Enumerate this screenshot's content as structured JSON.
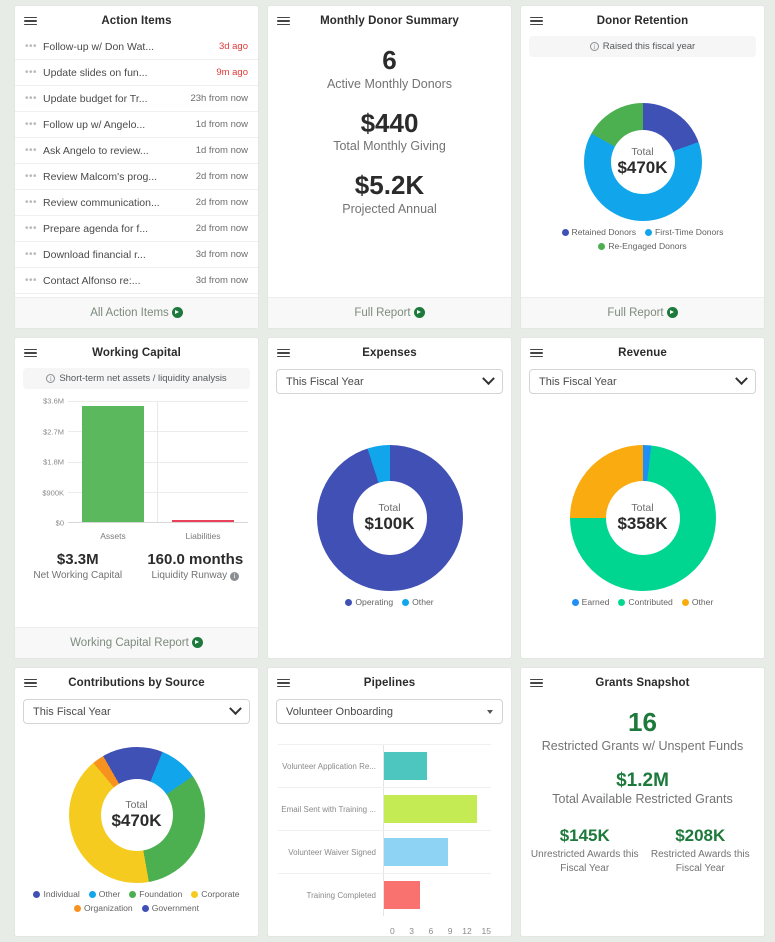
{
  "cards": {
    "action_items": {
      "title": "Action Items",
      "menu_icon": "hamburger-icon",
      "items": [
        {
          "label": "Follow-up w/ Don Wat...",
          "due": "3d ago",
          "overdue": true
        },
        {
          "label": "Update slides on fun...",
          "due": "9m ago",
          "overdue": true
        },
        {
          "label": "Update budget for Tr...",
          "due": "23h from now",
          "overdue": false
        },
        {
          "label": "Follow up w/ Angelo...",
          "due": "1d from now",
          "overdue": false
        },
        {
          "label": "Ask Angelo to review...",
          "due": "1d from now",
          "overdue": false
        },
        {
          "label": "Review Malcom's prog...",
          "due": "2d from now",
          "overdue": false
        },
        {
          "label": "Review communication...",
          "due": "2d from now",
          "overdue": false
        },
        {
          "label": "Prepare agenda for f...",
          "due": "2d from now",
          "overdue": false
        },
        {
          "label": "Download financial r...",
          "due": "3d from now",
          "overdue": false
        },
        {
          "label": "Contact Alfonso re:...",
          "due": "3d from now",
          "overdue": false
        }
      ],
      "footer": "All Action Items"
    },
    "monthly_donor_summary": {
      "title": "Monthly Donor Summary",
      "stats": [
        {
          "value": "6",
          "label": "Active Monthly Donors"
        },
        {
          "value": "$440",
          "label": "Total Monthly Giving"
        },
        {
          "value": "$5.2K",
          "label": "Projected Annual"
        }
      ],
      "footer": "Full Report"
    },
    "donor_retention": {
      "title": "Donor Retention",
      "banner": "Raised this fiscal year",
      "center_label": "Total",
      "center_value": "$470K",
      "footer": "Full Report"
    },
    "working_capital": {
      "title": "Working Capital",
      "banner": "Short-term net assets / liquidity analysis",
      "stats": [
        {
          "value": "$3.3M",
          "label": "Net Working Capital",
          "info": false
        },
        {
          "value": "160.0 months",
          "label": "Liquidity Runway",
          "info": true
        }
      ],
      "footer": "Working Capital Report"
    },
    "expenses": {
      "title": "Expenses",
      "filter": "This Fiscal Year",
      "center_label": "Total",
      "center_value": "$100K"
    },
    "revenue": {
      "title": "Revenue",
      "filter": "This Fiscal Year",
      "center_label": "Total",
      "center_value": "$358K"
    },
    "contributions_by_source": {
      "title": "Contributions by Source",
      "filter": "This Fiscal Year",
      "center_label": "Total",
      "center_value": "$470K"
    },
    "pipelines": {
      "title": "Pipelines",
      "filter": "Volunteer Onboarding"
    },
    "grants_snapshot": {
      "title": "Grants Snapshot",
      "stats": [
        {
          "value": "16",
          "label": "Restricted Grants w/ Unspent Funds"
        },
        {
          "value": "$1.2M",
          "label": "Total Available Restricted Grants"
        }
      ],
      "two_up": [
        {
          "value": "$145K",
          "label": "Unrestricted Awards this Fiscal Year"
        },
        {
          "value": "$208K",
          "label": "Restricted Awards this Fiscal Year"
        }
      ]
    }
  },
  "chart_data": [
    {
      "id": "donor_retention",
      "type": "pie",
      "title": "Donor Retention",
      "center_label": "Total",
      "center_value": "$470K",
      "total": 470000,
      "legend_position": "bottom",
      "categories": [
        "Retained Donors",
        "First-Time Donors",
        "Re-Engaged Donors"
      ],
      "values": [
        19.5,
        63.5,
        17.0
      ],
      "colors": [
        "#3f51b5",
        "#11a5ec",
        "#4caf50"
      ]
    },
    {
      "id": "working_capital",
      "type": "bar",
      "title": "Working Capital",
      "categories": [
        "Assets",
        "Liabilities"
      ],
      "values": [
        3450000,
        45000
      ],
      "colors": [
        "#5cb85c",
        "#e8415a"
      ],
      "ylim": [
        0,
        3600000
      ],
      "yticks": [
        "$0",
        "$900K",
        "$1.8M",
        "$2.7M",
        "$3.6M"
      ],
      "xlabel": "",
      "ylabel": "",
      "grid": true
    },
    {
      "id": "expenses",
      "type": "pie",
      "title": "Expenses",
      "center_label": "Total",
      "center_value": "$100K",
      "total": 100000,
      "legend_position": "bottom",
      "categories": [
        "Operating",
        "Other"
      ],
      "values": [
        95.0,
        5.0
      ],
      "colors": [
        "#4050b5",
        "#11a5ec"
      ]
    },
    {
      "id": "revenue",
      "type": "pie",
      "title": "Revenue",
      "center_label": "Total",
      "center_value": "$358K",
      "total": 358000,
      "legend_position": "bottom",
      "categories": [
        "Earned",
        "Contributed",
        "Other"
      ],
      "values": [
        1.8,
        73.2,
        25.0
      ],
      "colors": [
        "#1f8ff5",
        "#00d68f",
        "#f9ab10"
      ]
    },
    {
      "id": "contributions_by_source",
      "type": "pie",
      "title": "Contributions by Source",
      "center_label": "Total",
      "center_value": "$470K",
      "total": 470000,
      "legend_position": "bottom",
      "categories": [
        "Individual",
        "Other",
        "Foundation",
        "Corporate",
        "Organization",
        "Government"
      ],
      "values": [
        6.1,
        9.2,
        31.9,
        41.7,
        2.8,
        8.3
      ],
      "colors": [
        "#3f51b5",
        "#11a5ec",
        "#4caf50",
        "#f5cb1f",
        "#f7921e",
        "#3f51b5"
      ]
    },
    {
      "id": "pipelines",
      "type": "bar",
      "title": "Pipelines",
      "orientation": "horizontal",
      "categories": [
        "Volunteer Application Re...",
        "Email Sent with Training ...",
        "Volunteer Waiver Signed",
        "Training Completed"
      ],
      "values": [
        6,
        13,
        9,
        5
      ],
      "colors": [
        "#4ec6c0",
        "#c4ea54",
        "#8fd3f4",
        "#f9726f"
      ],
      "xlim": [
        0,
        15
      ],
      "xticks": [
        "0",
        "3",
        "6",
        "9",
        "12",
        "15"
      ],
      "grid": true
    }
  ]
}
